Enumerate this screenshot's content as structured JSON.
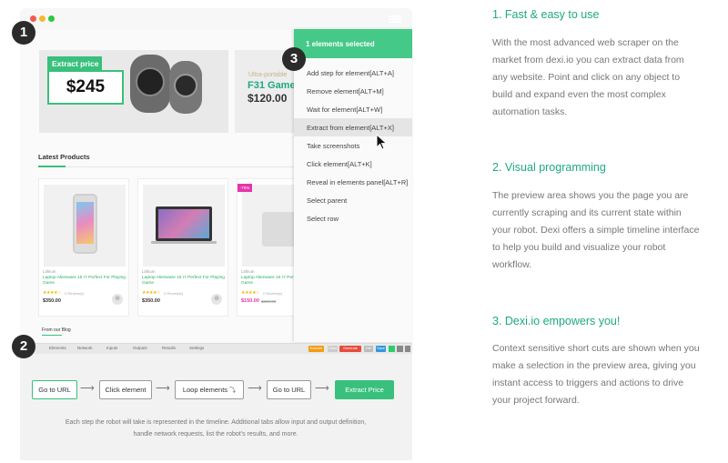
{
  "colors": {
    "accent": "#39c07c",
    "heading": "#1ea982",
    "body_text": "#777777",
    "menu_header": "#45c988",
    "sale_badge": "#e535ab"
  },
  "browser": {
    "window_dots": [
      "#f35b4c",
      "#f5b82e",
      "#2bc840"
    ]
  },
  "hero": {
    "extract_tag": "Extract price",
    "extract_value": "$245",
    "promo_small": "Ultra-portable",
    "promo_title": "F31 Game",
    "promo_price": "$120.00"
  },
  "products": {
    "section_title": "Latest Products",
    "items": [
      {
        "brand": "Lithium",
        "name": "Laptop Alienware 15 I7 Perfect For Playing Game",
        "stars": "★★★★☆",
        "reviews": "0 Review(s)",
        "price": "$350.00",
        "discount": "",
        "old_price": ""
      },
      {
        "brand": "Lithium",
        "name": "Laptop Alienware 15 I7 Perfect For Playing Game",
        "stars": "★★★★☆",
        "reviews": "0 Review(s)",
        "price": "$350.00",
        "discount": "",
        "old_price": ""
      },
      {
        "brand": "Lithium",
        "name": "Laptop Alienware 15 I7 Perfect For Playing Game",
        "stars": "★★★★☆",
        "reviews": "0 Review(s)",
        "price": "$150.00",
        "discount": "-75%",
        "old_price": "$300.00"
      }
    ],
    "blog_title": "From our Blog"
  },
  "context_menu": {
    "header": "1 elements selected",
    "items": [
      {
        "label": "Add step for element",
        "shortcut": "[ALT+A]"
      },
      {
        "label": "Remove element",
        "shortcut": "[ALT+M]"
      },
      {
        "label": "Wait for element",
        "shortcut": "[ALT+W]"
      },
      {
        "label": "Extract from element",
        "shortcut": "[ALT+X]"
      },
      {
        "label": "Take screenshots",
        "shortcut": ""
      },
      {
        "label": "Click element",
        "shortcut": "[ALT+K]"
      },
      {
        "label": "Reveal in elements panel",
        "shortcut": "[ALT+R]"
      },
      {
        "label": "Select parent",
        "shortcut": ""
      },
      {
        "label": "Select row",
        "shortcut": ""
      }
    ],
    "highlighted_index": 3
  },
  "timeline": {
    "tabs": [
      "Elements",
      "Network",
      "Inputs",
      "Outputs",
      "Results",
      "Settings"
    ],
    "badges": [
      "Execute",
      "Clear",
      "Generate",
      "Edit",
      "Save"
    ],
    "steps": [
      "Go to URL",
      "Click element",
      "Loop elements",
      "Go to URL",
      "Extract Price"
    ],
    "loop_icon": "⤵",
    "caption": "Each step the robot will take is represented in the timeline. Additional tabs allow input and output definition, handle network requests, list the robot's results, and more."
  },
  "markers": [
    "1",
    "2",
    "3"
  ],
  "features": [
    {
      "title": "1. Fast & easy to use",
      "lines": [
        "With the most advanced web scraper on the",
        "market from dexi.io you can extract data from",
        "any website. Point and click on any object to",
        "build and expand even the most complex",
        "automation tasks."
      ]
    },
    {
      "title": "2. Visual programming",
      "lines": [
        "The preview area shows you the page you are",
        "currently scraping and its current state within",
        "your robot. Dexi offers a simple timeline interface",
        "to help you build and visualize your robot",
        "workflow."
      ]
    },
    {
      "title": "3. Dexi.io empowers you!",
      "lines": [
        "Context sensitive short cuts are shown when you",
        "make a selection in the preview area, giving you",
        "instant access to triggers and actions to drive",
        "your project forward."
      ]
    }
  ]
}
